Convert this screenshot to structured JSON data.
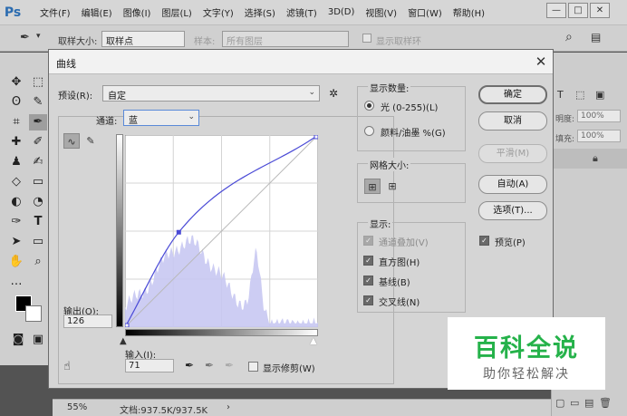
{
  "app": {
    "logo": "Ps",
    "menu": [
      "文件(F)",
      "编辑(E)",
      "图像(I)",
      "图层(L)",
      "文字(Y)",
      "选择(S)",
      "滤镜(T)",
      "3D(D)",
      "视图(V)",
      "窗口(W)",
      "帮助(H)"
    ],
    "window_buttons": [
      "—",
      "□",
      "✕"
    ]
  },
  "options": {
    "sample_size_label": "取样大小:",
    "sample_size_value": "取样点",
    "sample_label": "样本:",
    "sample_value": "所有图层",
    "show_ring_label": "显示取样环"
  },
  "right_panel": {
    "opacity_label": "明度:",
    "opacity_value": "100%",
    "fill_label": "填充:",
    "fill_value": "100%"
  },
  "status": {
    "zoom": "55%",
    "doc": "文档:937.5K/937.5K"
  },
  "dialog": {
    "title": "曲线",
    "close": "✕",
    "preset_label": "预设(R):",
    "preset_value": "自定",
    "channel_label": "通道:",
    "channel_value": "蓝",
    "output_label": "输出(O):",
    "output_value": "126",
    "input_label": "输入(I):",
    "input_value": "71",
    "show_clipping": "显示修剪(W)",
    "show_amount": {
      "title": "显示数量:",
      "light": "光 (0-255)(L)",
      "pigment": "颜料/油墨 %(G)",
      "selected": "light"
    },
    "grid_size": {
      "title": "网格大小:"
    },
    "display": {
      "title": "显示:",
      "channel_overlay": "通道叠加(V)",
      "histogram": "直方图(H)",
      "baseline": "基线(B)",
      "intersection": "交叉线(N)"
    },
    "buttons": {
      "ok": "确定",
      "cancel": "取消",
      "smooth": "平滑(M)",
      "auto": "自动(A)",
      "options": "选项(T)..."
    },
    "preview_label": "预览(P)",
    "curve_points": [
      [
        0,
        0
      ],
      [
        71,
        126
      ],
      [
        255,
        255
      ]
    ],
    "curve_color": "#4a4ad6",
    "histogram_color": "#c8c8f2"
  },
  "watermark": {
    "title": "百科全说",
    "subtitle": "助你轻松解决"
  }
}
